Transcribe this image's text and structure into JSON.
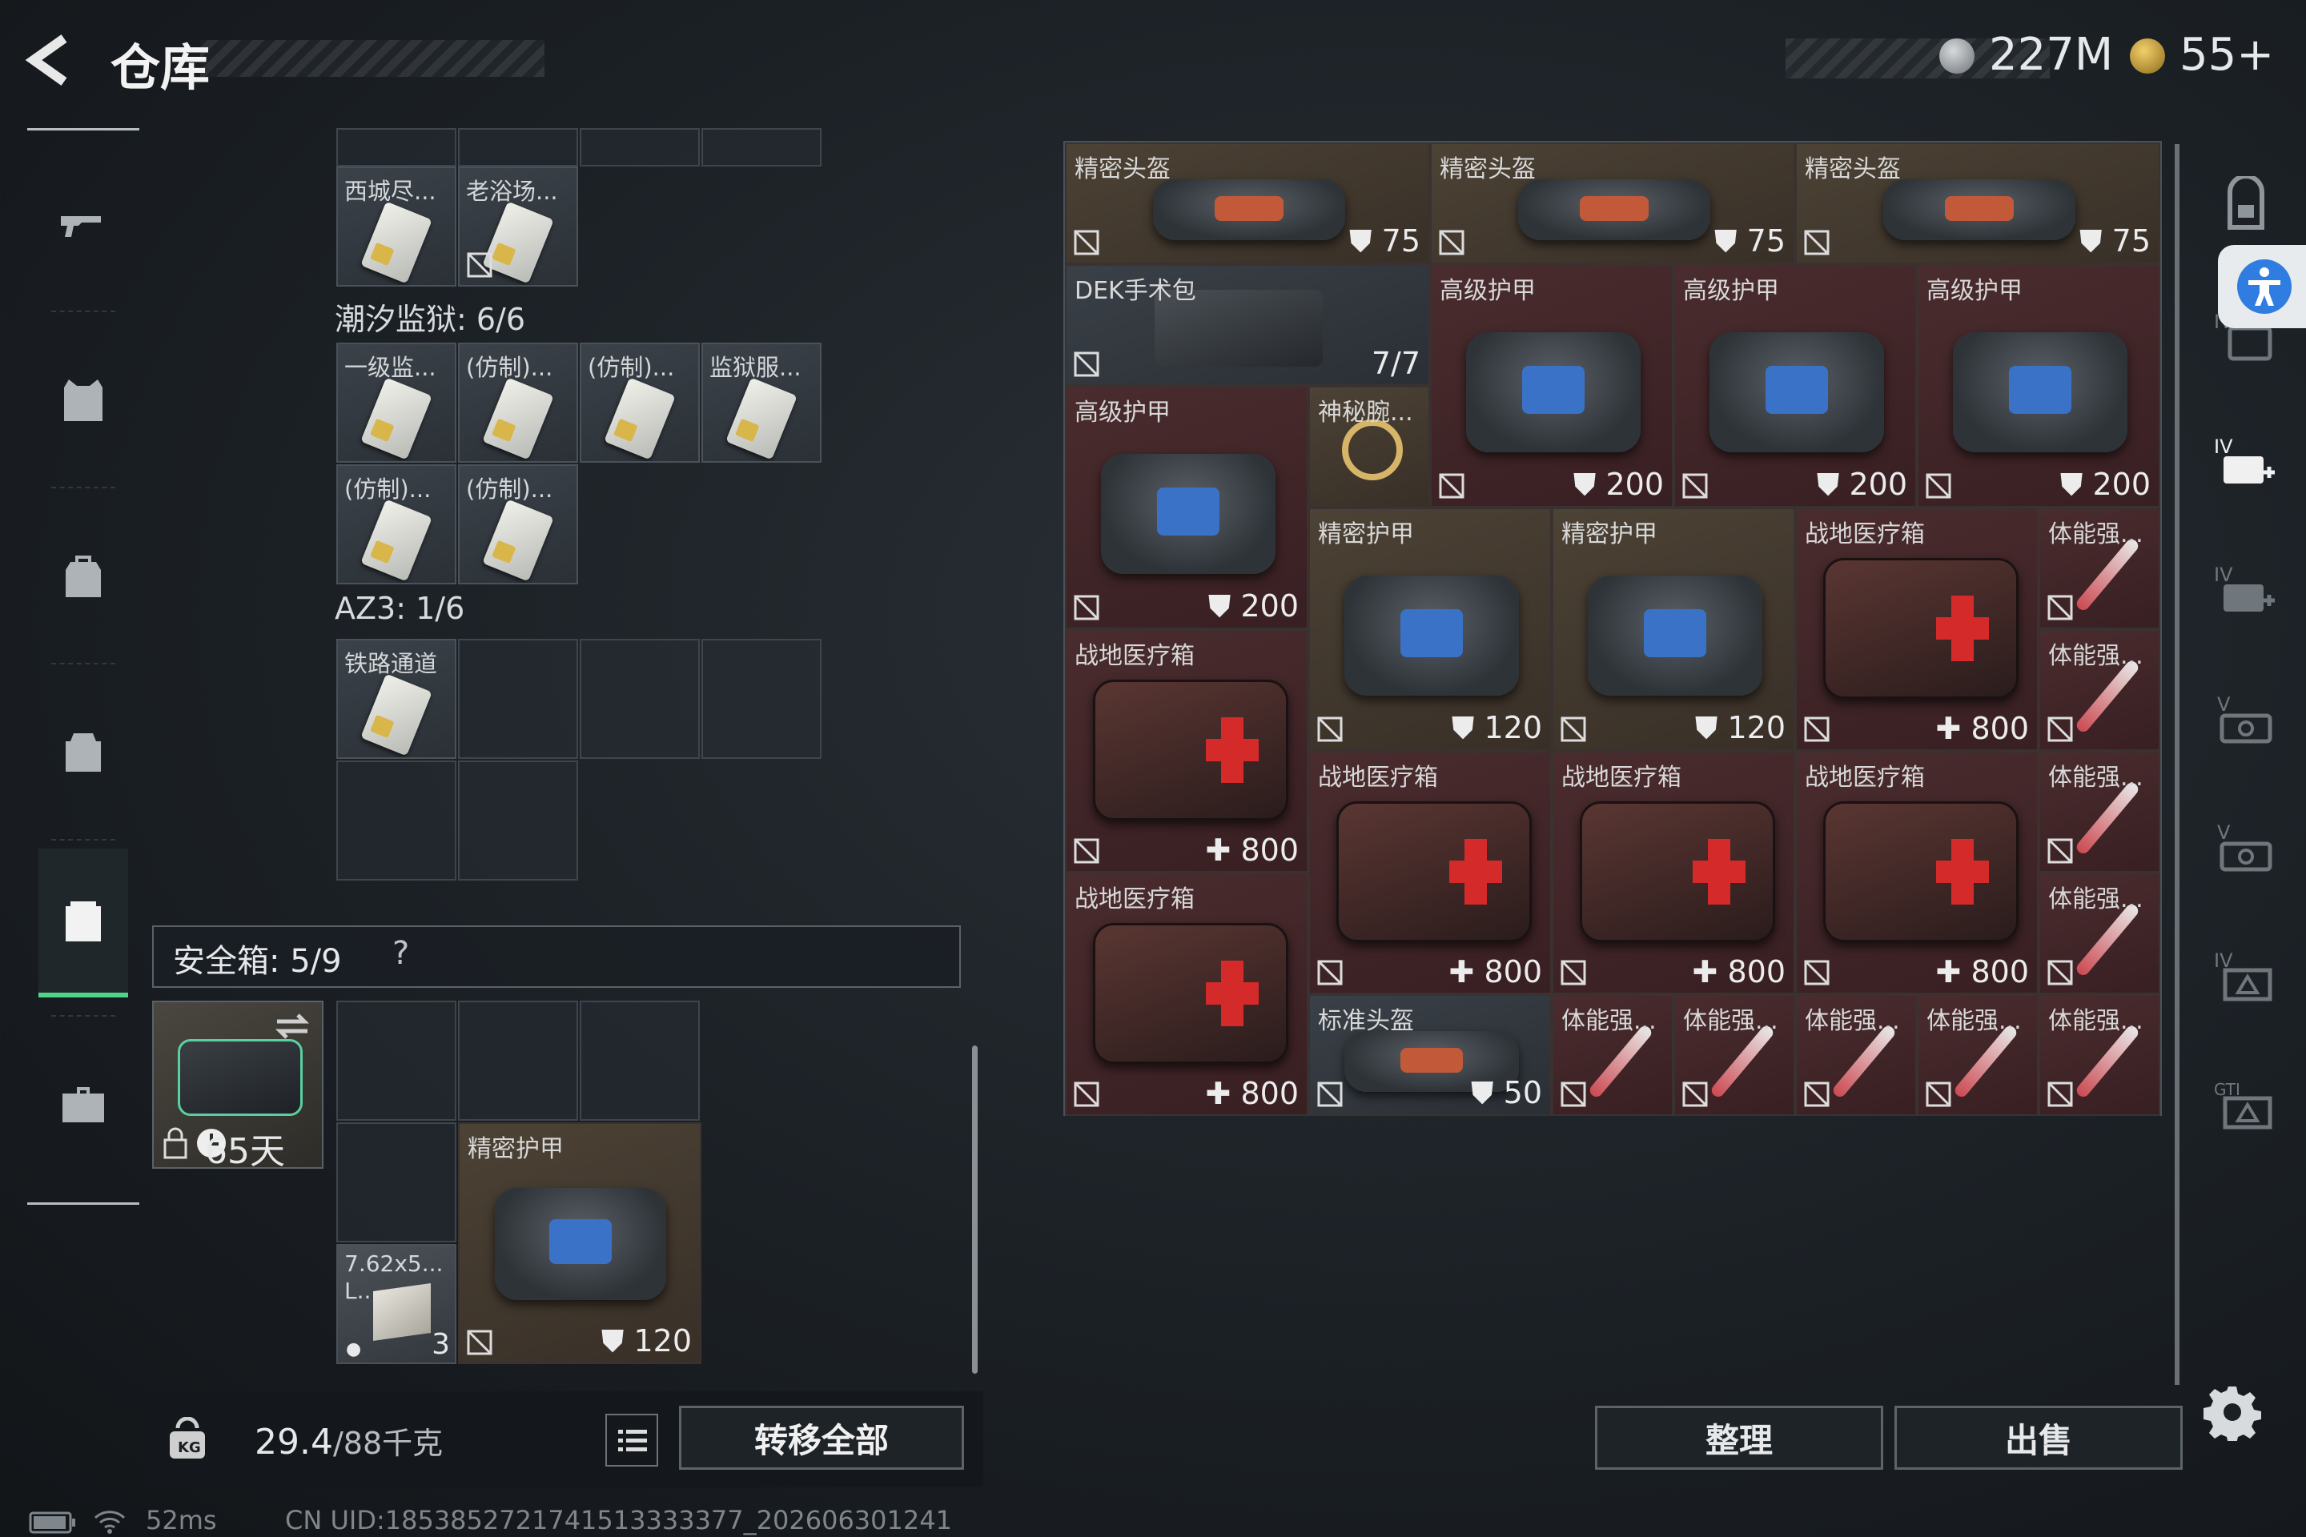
{
  "header": {
    "title": "仓库",
    "currencies": [
      {
        "icon": "silver-coin-icon",
        "value": "227M"
      },
      {
        "icon": "gold-triangle-icon",
        "value": "55+"
      }
    ]
  },
  "left_nav": [
    {
      "icon": "gun-icon"
    },
    {
      "icon": "armor-vest-icon"
    },
    {
      "icon": "backpack-icon"
    },
    {
      "icon": "chest-rig-icon"
    },
    {
      "icon": "container-icon",
      "active": true
    },
    {
      "icon": "briefcase-icon"
    }
  ],
  "keycards": {
    "top_items": [
      {
        "name": "西城尽..."
      },
      {
        "name": "老浴场..."
      }
    ],
    "section1": {
      "label": "潮汐监狱: 6/6",
      "items": [
        {
          "name": "一级监..."
        },
        {
          "name": "(仿制)..."
        },
        {
          "name": "(仿制)..."
        },
        {
          "name": "监狱服..."
        },
        {
          "name": "(仿制)..."
        },
        {
          "name": "(仿制)..."
        }
      ]
    },
    "section2": {
      "label": "AZ3: 1/6",
      "items": [
        {
          "name": "铁路通道"
        }
      ]
    }
  },
  "safe_box": {
    "label": "安全箱: 5/9",
    "help": "?",
    "days": "65天",
    "items": [
      {
        "name": "7.62x5...",
        "sub": "L...",
        "count": "3"
      },
      {
        "name": "精密护甲",
        "value": "120"
      }
    ]
  },
  "footer": {
    "weight": "29.4",
    "weight_total": "/88千克",
    "transfer_all": "转移全部",
    "sort": "整理",
    "sell": "出售"
  },
  "stash_items": [
    {
      "name": "精密头盔",
      "value": "75",
      "type": "helmet"
    },
    {
      "name": "精密头盔",
      "value": "75",
      "type": "helmet"
    },
    {
      "name": "精密头盔",
      "value": "75",
      "type": "helmet"
    },
    {
      "name": "DEK手术包",
      "value": "7/7",
      "type": "surgery"
    },
    {
      "name": "高级护甲",
      "value": "200",
      "type": "armor"
    },
    {
      "name": "高级护甲",
      "value": "200",
      "type": "armor"
    },
    {
      "name": "高级护甲",
      "value": "200",
      "type": "armor"
    },
    {
      "name": "高级护甲",
      "value": "200",
      "type": "armor"
    },
    {
      "name": "神秘腕...",
      "value": "",
      "type": "watch"
    },
    {
      "name": "精密护甲",
      "value": "120",
      "type": "armor"
    },
    {
      "name": "精密护甲",
      "value": "120",
      "type": "armor"
    },
    {
      "name": "战地医疗箱",
      "value": "800",
      "type": "medkit"
    },
    {
      "name": "体能强...",
      "value": "",
      "type": "syringe"
    },
    {
      "name": "体能强...",
      "value": "",
      "type": "syringe"
    },
    {
      "name": "战地医疗箱",
      "value": "800",
      "type": "medkit"
    },
    {
      "name": "战地医疗箱",
      "value": "800",
      "type": "medkit"
    },
    {
      "name": "战地医疗箱",
      "value": "800",
      "type": "medkit"
    },
    {
      "name": "战地医疗箱",
      "value": "800",
      "type": "medkit"
    },
    {
      "name": "体能强...",
      "value": "",
      "type": "syringe"
    },
    {
      "name": "战地医疗箱",
      "value": "800",
      "type": "medkit"
    },
    {
      "name": "体能强...",
      "value": "",
      "type": "syringe"
    },
    {
      "name": "标准头盔",
      "value": "50",
      "type": "helmet"
    },
    {
      "name": "体能强...",
      "value": "",
      "type": "syringe"
    },
    {
      "name": "体能强...",
      "value": "",
      "type": "syringe"
    },
    {
      "name": "体能强...",
      "value": "",
      "type": "syringe"
    },
    {
      "name": "体能强...",
      "value": "",
      "type": "syringe"
    },
    {
      "name": "体能强...",
      "value": "",
      "type": "syringe"
    }
  ],
  "right_sidebar": [
    {
      "icon": "safe-box-icon"
    },
    {
      "icon": "armor-plate-iv-icon"
    },
    {
      "icon": "medkit-iv-icon"
    },
    {
      "icon": "medkit-iv-icon"
    },
    {
      "icon": "key-v-icon"
    },
    {
      "icon": "key-v-icon"
    },
    {
      "icon": "ticket-iv-icon"
    },
    {
      "icon": "ticket-gti-icon"
    }
  ],
  "status_bar": {
    "ping": "52ms",
    "uid": "CN UID:1853852721741513333377_202606301241"
  }
}
